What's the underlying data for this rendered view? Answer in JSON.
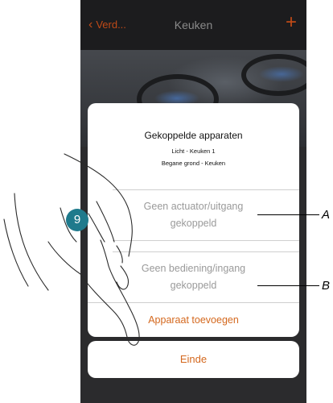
{
  "navbar": {
    "back_label": "Verd...",
    "title": "Keuken",
    "add_symbol": "+"
  },
  "dialog": {
    "title": "Gekoppelde apparaten",
    "subtitle1": "Licht - Keuken 1",
    "subtitle2": "Begane grond - Keuken",
    "actuator_line1": "Geen actuator/uitgang",
    "actuator_line2": "gekoppeld",
    "control_line1": "Geen bediening/ingang",
    "control_line2": "gekoppeld",
    "add_label": "Apparaat toevoegen"
  },
  "end_button": {
    "label": "Einde"
  },
  "annotations": {
    "step": "9",
    "callout_a": "A",
    "callout_b": "B"
  },
  "colors": {
    "accent": "#d4681e",
    "badge": "#1f7a8c"
  }
}
